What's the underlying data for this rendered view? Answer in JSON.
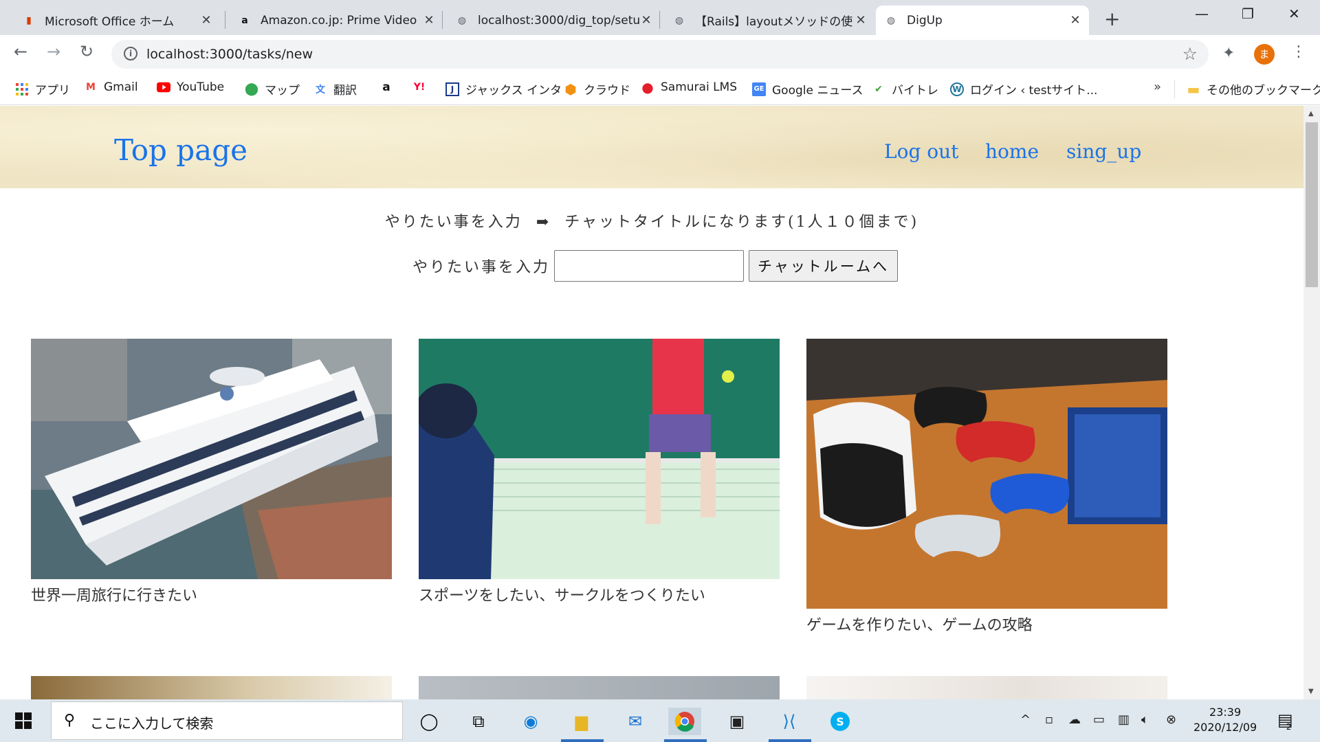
{
  "browser": {
    "tabs": [
      {
        "title": "Microsoft Office ホーム",
        "icon": "office-icon",
        "active": false
      },
      {
        "title": "Amazon.co.jp: Prime Video",
        "icon": "amazon-icon",
        "active": false
      },
      {
        "title": "localhost:3000/dig_top/setu",
        "icon": "globe-icon",
        "active": false
      },
      {
        "title": "【Rails】layoutメソッドの使い方",
        "icon": "globe-icon",
        "active": false
      },
      {
        "title": "DigUp",
        "icon": "globe-icon",
        "active": true
      }
    ],
    "url": "localhost:3000/tasks/new",
    "profile_initial": "ま",
    "bookmarks": [
      {
        "label": "アプリ",
        "icon": "apps-grid-icon"
      },
      {
        "label": "Gmail",
        "icon": "gmail-icon"
      },
      {
        "label": "YouTube",
        "icon": "youtube-icon"
      },
      {
        "label": "マップ",
        "icon": "maps-pin-icon"
      },
      {
        "label": "翻訳",
        "icon": "translate-icon"
      },
      {
        "label": "",
        "icon": "amazon-icon"
      },
      {
        "label": "",
        "icon": "yahoo-icon"
      },
      {
        "label": "ジャックス インタ",
        "icon": "jaccs-icon"
      },
      {
        "label": "クラウド",
        "icon": "cloud-box-icon"
      },
      {
        "label": "Samurai LMS",
        "icon": "samurai-icon"
      },
      {
        "label": "Google ニュース",
        "icon": "google-news-icon"
      },
      {
        "label": "バイトレ",
        "icon": "baitore-icon"
      },
      {
        "label": "ログイン ‹ testサイト...",
        "icon": "wordpress-icon"
      }
    ],
    "other_bookmarks": "その他のブックマーク"
  },
  "page": {
    "site_title": "Top page",
    "nav": {
      "logout": "Log out",
      "home": "home",
      "signup": "sing_up"
    },
    "intro_left": "やりたい事を入力",
    "intro_arrow": "➡",
    "intro_right": "チャットタイトルになります(1人１０個まで)",
    "form_label": "やりたい事を入力",
    "input_value": "",
    "submit_label": "チャットルームへ",
    "cards": [
      {
        "caption": "世界一周旅行に行きたい",
        "image": "cruise-ship-photo"
      },
      {
        "caption": "スポーツをしたい、サークルをつくりたい",
        "image": "tennis-player-photo"
      },
      {
        "caption": "ゲームを作りたい、ゲームの攻略",
        "image": "game-controllers-photo"
      }
    ]
  },
  "taskbar": {
    "search_placeholder": "ここに入力して検索",
    "time": "23:39",
    "date": "2020/12/09",
    "notification_count": "2"
  },
  "colors": {
    "link_blue": "#1a73e8",
    "header_beige": "#efe4c3",
    "taskbar": "#dfe8ee"
  }
}
